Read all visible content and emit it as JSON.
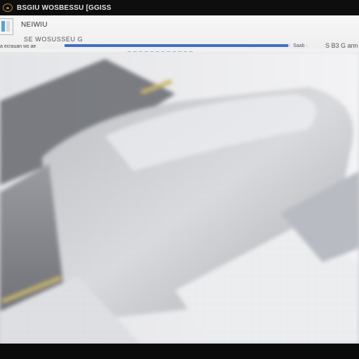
{
  "titlebar": {
    "icon": "app-icon",
    "title": "BSGIU WOSBESSU [GGISS"
  },
  "header": {
    "doc_icon": "document-icon",
    "tab_title": "NEIWIU",
    "subtitle": "SE WOSUSSEU G",
    "status_left": "a ecrauan ws ae",
    "status_right": "Saab ·",
    "status_count": "S B3 G ann",
    "progress": 0.99,
    "accent": "#3f6fc4"
  },
  "viewport": {
    "content": "blurred-preview-image"
  }
}
